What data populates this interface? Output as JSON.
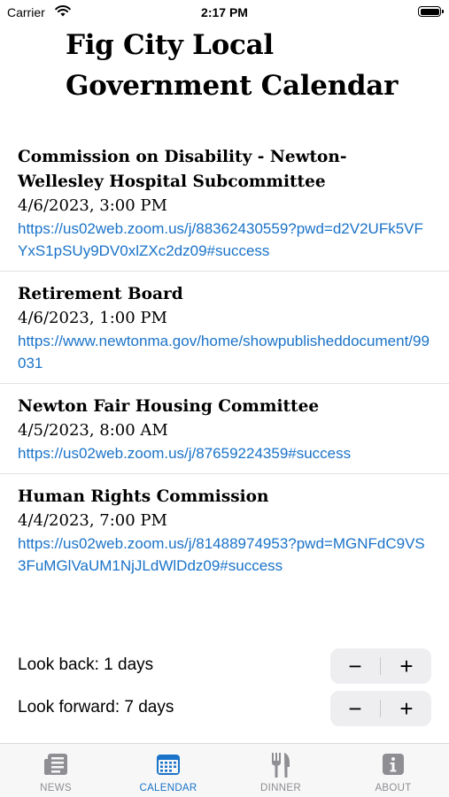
{
  "status": {
    "carrier": "Carrier",
    "time": "2:17 PM"
  },
  "title": "Fig City Local Government Calendar",
  "events": [
    {
      "title": "Commission on Disability - Newton-Wellesley Hospital Subcommittee",
      "date": "4/6/2023, 3:00 PM",
      "link": "https://us02web.zoom.us/j/88362430559?pwd=d2V2UFk5VFYxS1pSUy9DV0xlZXc2dz09#success"
    },
    {
      "title": "Retirement Board",
      "date": "4/6/2023, 1:00 PM",
      "link": "https://www.newtonma.gov/home/showpublisheddocument/99031"
    },
    {
      "title": "Newton Fair Housing Committee",
      "date": "4/5/2023, 8:00 AM",
      "link": "https://us02web.zoom.us/j/87659224359#success"
    },
    {
      "title": "Human Rights Commission",
      "date": "4/4/2023, 7:00 PM",
      "link": "https://us02web.zoom.us/j/81488974953?pwd=MGNFdC9VS3FuMGlVaUM1NjJLdWlDdz09#success"
    }
  ],
  "controls": {
    "look_back": {
      "label": "Look back: 1 days",
      "minus": "−",
      "plus": "+"
    },
    "look_forward": {
      "label": "Look forward: 7 days",
      "minus": "−",
      "plus": "+"
    }
  },
  "tabs": [
    {
      "label": "NEWS",
      "icon": "newspaper-icon"
    },
    {
      "label": "CALENDAR",
      "icon": "calendar-icon",
      "active": true
    },
    {
      "label": "DINNER",
      "icon": "fork-knife-icon"
    },
    {
      "label": "ABOUT",
      "icon": "info-icon"
    }
  ],
  "colors": {
    "accent": "#1a73c9",
    "inactive_tab": "#8e8e93",
    "stepper_bg": "#eeeef0"
  }
}
